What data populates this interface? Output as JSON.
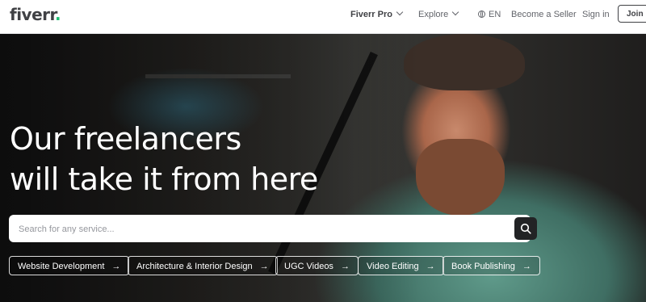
{
  "header": {
    "logo": "fiverr",
    "logo_dot": ".",
    "nav": {
      "pro": "Fiverr Pro",
      "explore": "Explore",
      "language": "EN",
      "become_seller": "Become a Seller",
      "sign_in": "Sign in",
      "join": "Join"
    }
  },
  "hero": {
    "headline_line1": "Our freelancers",
    "headline_line2": "will take it from here",
    "search": {
      "placeholder": "Search for any service..."
    },
    "chips": [
      {
        "label": "Website Development"
      },
      {
        "label": "Architecture & Interior Design"
      },
      {
        "label": "UGC Videos"
      },
      {
        "label": "Video Editing"
      },
      {
        "label": "Book Publishing"
      }
    ],
    "chip_arrow": "→"
  },
  "colors": {
    "brand_green": "#1dbf73",
    "text_dark": "#404145"
  },
  "icons": [
    "chevron-down-icon",
    "globe-icon",
    "search-icon",
    "arrow-right-icon"
  ]
}
